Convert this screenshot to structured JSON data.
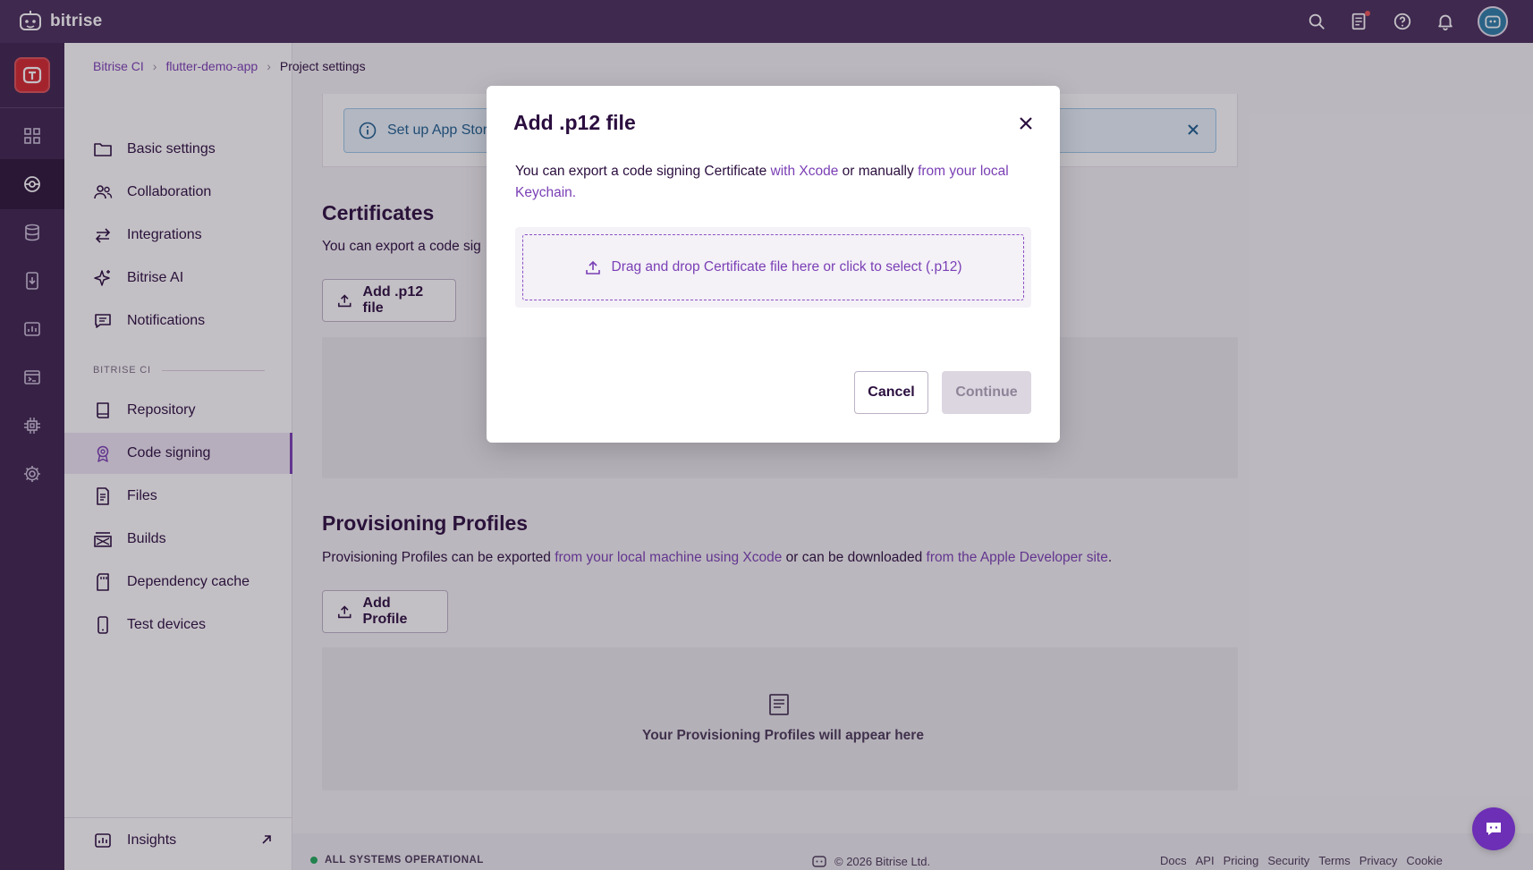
{
  "app": {
    "brand": "bitrise"
  },
  "breadcrumb": [
    "Bitrise CI",
    "flutter-demo-app",
    "Project settings"
  ],
  "sidebar": {
    "items": [
      {
        "label": "Basic settings"
      },
      {
        "label": "Collaboration"
      },
      {
        "label": "Integrations"
      },
      {
        "label": "Bitrise AI"
      },
      {
        "label": "Notifications"
      }
    ],
    "section_label": "BITRISE CI",
    "ci_items": [
      {
        "label": "Repository"
      },
      {
        "label": "Code signing",
        "active": true
      },
      {
        "label": "Files"
      },
      {
        "label": "Builds"
      },
      {
        "label": "Dependency cache"
      },
      {
        "label": "Test devices"
      }
    ],
    "insights_label": "Insights"
  },
  "main": {
    "banner_text": "Set up App Store",
    "certificates": {
      "title": "Certificates",
      "desc": "You can export a code sig",
      "add_button": "Add .p12 file"
    },
    "profiles": {
      "title": "Provisioning Profiles",
      "desc_prefix": "Provisioning Profiles can be exported ",
      "link1": "from your local machine using Xcode",
      "desc_mid": " or can be downloaded ",
      "link2": "from the Apple Developer site",
      "desc_suffix": ".",
      "add_button": "Add Profile",
      "empty_text": "Your Provisioning Profiles will appear here"
    }
  },
  "footer": {
    "status": "ALL SYSTEMS OPERATIONAL",
    "copyright": "© 2026 Bitrise Ltd.",
    "links": [
      "Docs",
      "API",
      "Pricing",
      "Security",
      "Terms",
      "Privacy",
      "Cookie"
    ]
  },
  "modal": {
    "title": "Add .p12 file",
    "text_prefix": "You can export a code signing Certificate ",
    "link1": "with Xcode",
    "text_mid": " or manually ",
    "link2": "from your local Keychain.",
    "drop_text": "Drag and drop Certificate file here or click to select (.p12)",
    "cancel": "Cancel",
    "continue": "Continue"
  },
  "colors": {
    "topbar": "#492f5c",
    "rail": "#3d2550",
    "accent": "#7a3fb5",
    "project_tile": "#d5272f"
  }
}
